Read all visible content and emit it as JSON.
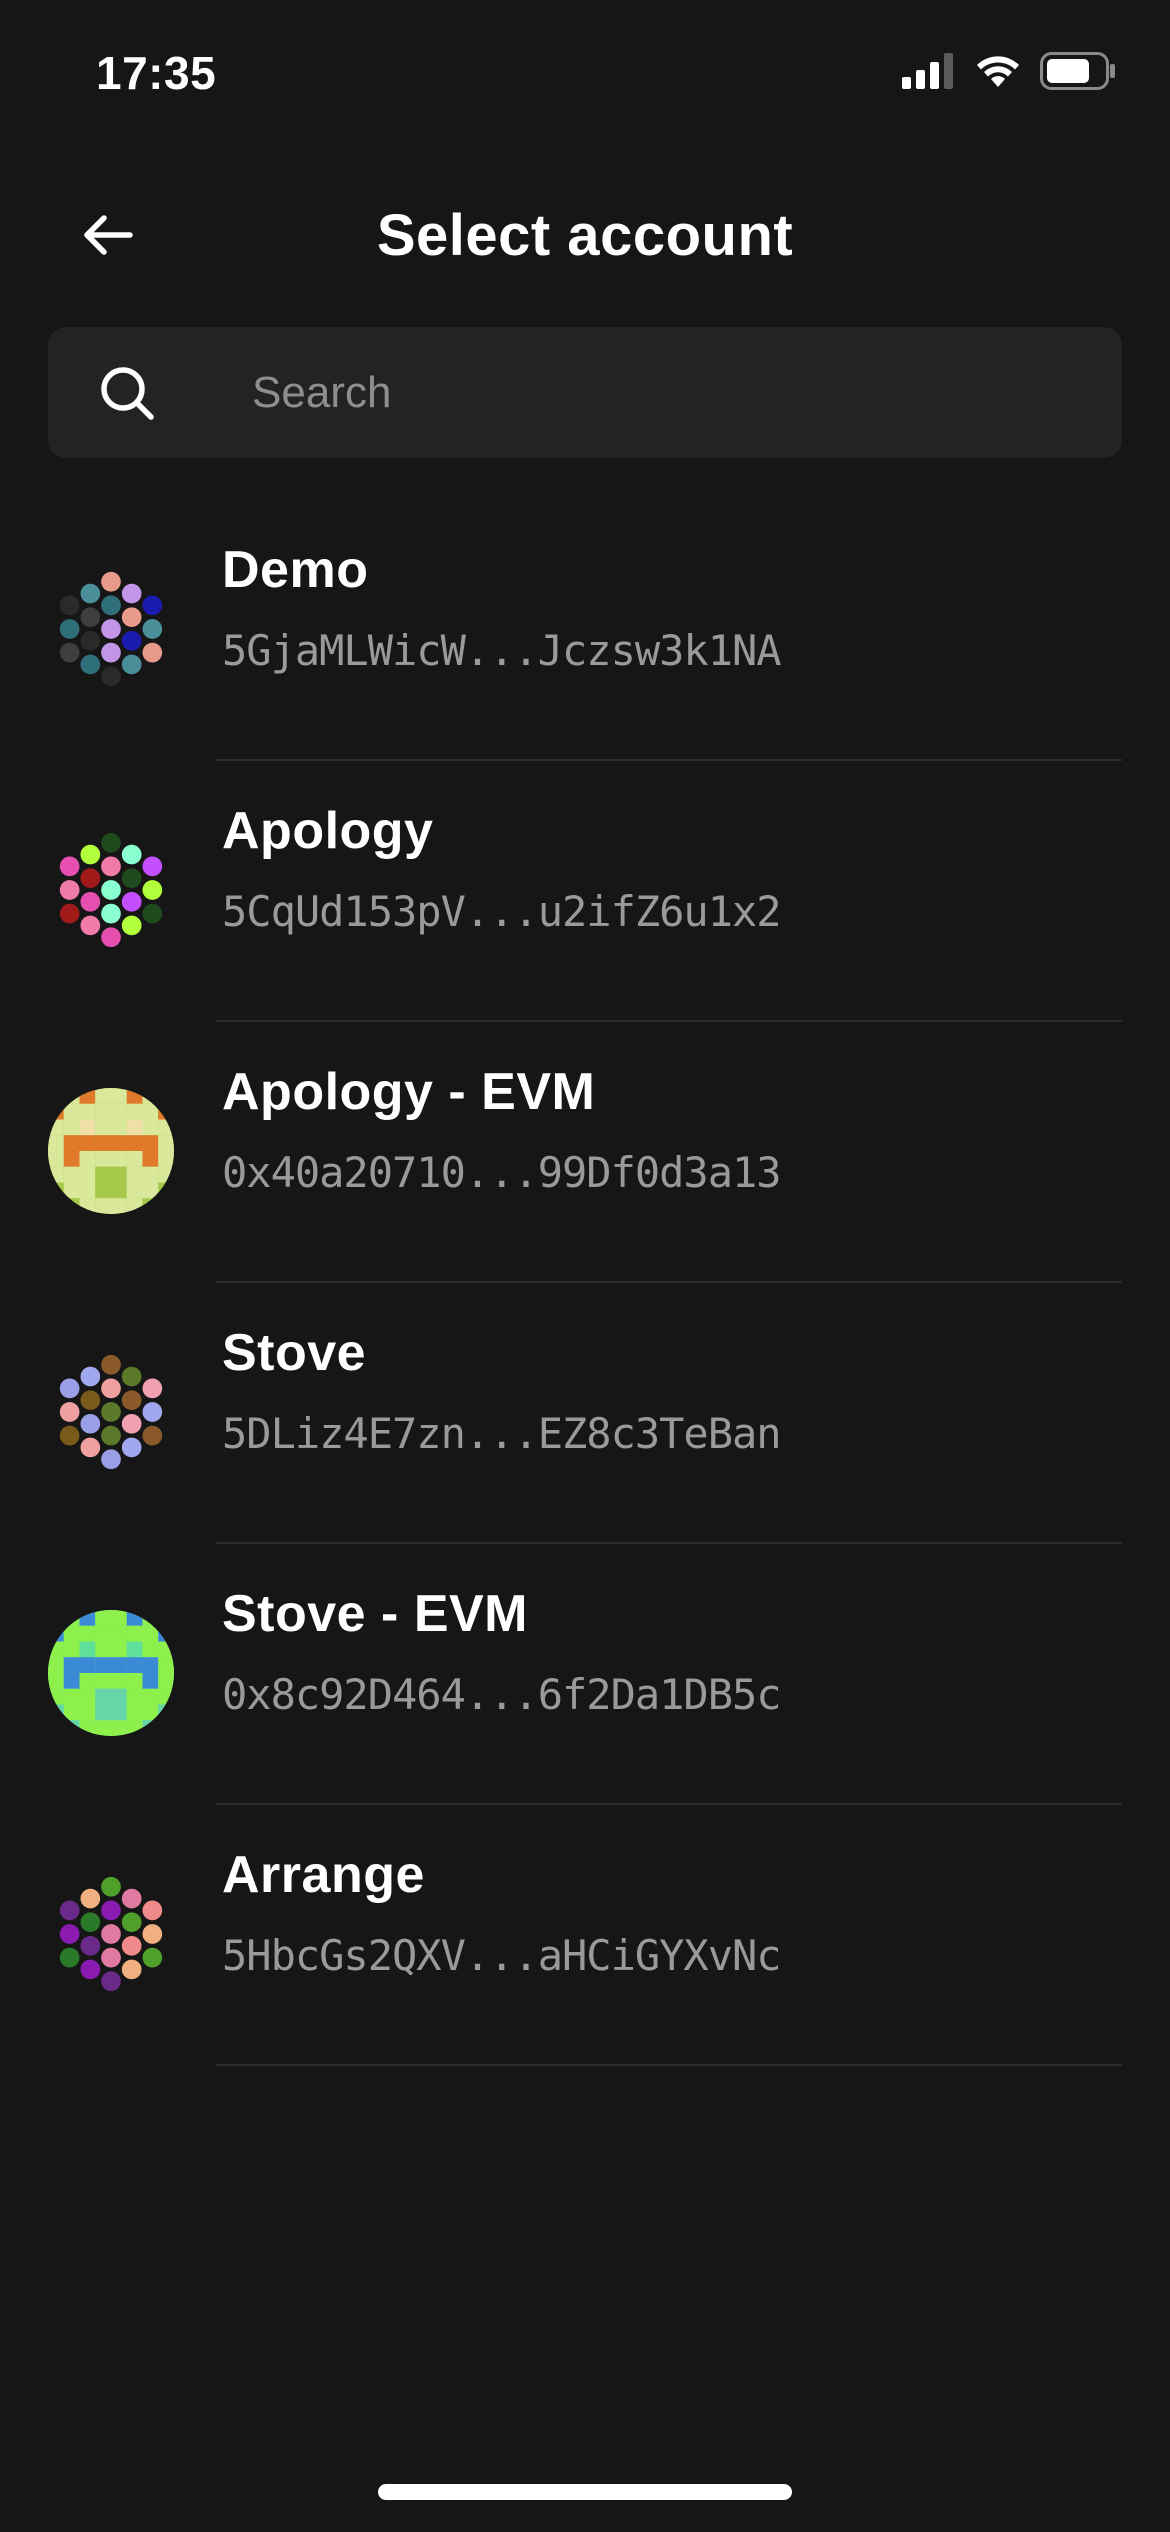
{
  "status_bar": {
    "time": "17:35",
    "icons": [
      "signal-icon",
      "wifi-icon",
      "battery-icon"
    ]
  },
  "header": {
    "title": "Select account",
    "back_icon": "arrow-left-icon"
  },
  "search": {
    "placeholder": "Search",
    "value": "",
    "icon": "search-icon"
  },
  "accounts": [
    {
      "name": "Demo",
      "address": "5GjaMLWicW...Jczsw3k1NA",
      "avatar_type": "polkadot",
      "avatar_colors": [
        "#e89a8a",
        "#2f6f7a",
        "#4a8e9a",
        "#c395e8",
        "#2a2a2a",
        "#1b1bb0",
        "#3e3e3e"
      ]
    },
    {
      "name": "Apology",
      "address": "5CqUd153pV...u2ifZ6u1x2",
      "avatar_type": "polkadot",
      "avatar_colors": [
        "#1e4a1e",
        "#f07aa8",
        "#b2ff3c",
        "#8affd0",
        "#e64fb0",
        "#c34fff",
        "#a01a1a"
      ]
    },
    {
      "name": "Apology - EVM",
      "address": "0x40a20710...99Df0d3a13",
      "avatar_type": "evm",
      "avatar_colors": [
        "#a6c84a",
        "#d9e89a",
        "#e07a2a",
        "#f0e0a8"
      ]
    },
    {
      "name": "Stove",
      "address": "5DLiz4E7zn...EZ8c3TeBan",
      "avatar_type": "polkadot",
      "avatar_colors": [
        "#8a5a2a",
        "#f0a0a0",
        "#a0a8f0",
        "#5a7a2a",
        "#9aa0e8",
        "#f0a0b0",
        "#7a5a1a"
      ]
    },
    {
      "name": "Stove - EVM",
      "address": "0x8c92D464...6f2Da1DB5c",
      "avatar_type": "evm",
      "avatar_colors": [
        "#66d6a8",
        "#8ef04a",
        "#3a8ad6",
        "#5fe09a"
      ]
    },
    {
      "name": "Arrange",
      "address": "5HbcGs2QXV...aHCiGYXvNc",
      "avatar_type": "polkadot",
      "avatar_colors": [
        "#4ea02a",
        "#8a1ab0",
        "#f0b080",
        "#e07aa0",
        "#6a2a8a",
        "#f08a8a",
        "#2a7a2a"
      ]
    }
  ],
  "colors": {
    "background": "#161616",
    "search_background": "#232323",
    "secondary_text": "#9a9a9a",
    "divider": "#2b2b2b"
  }
}
